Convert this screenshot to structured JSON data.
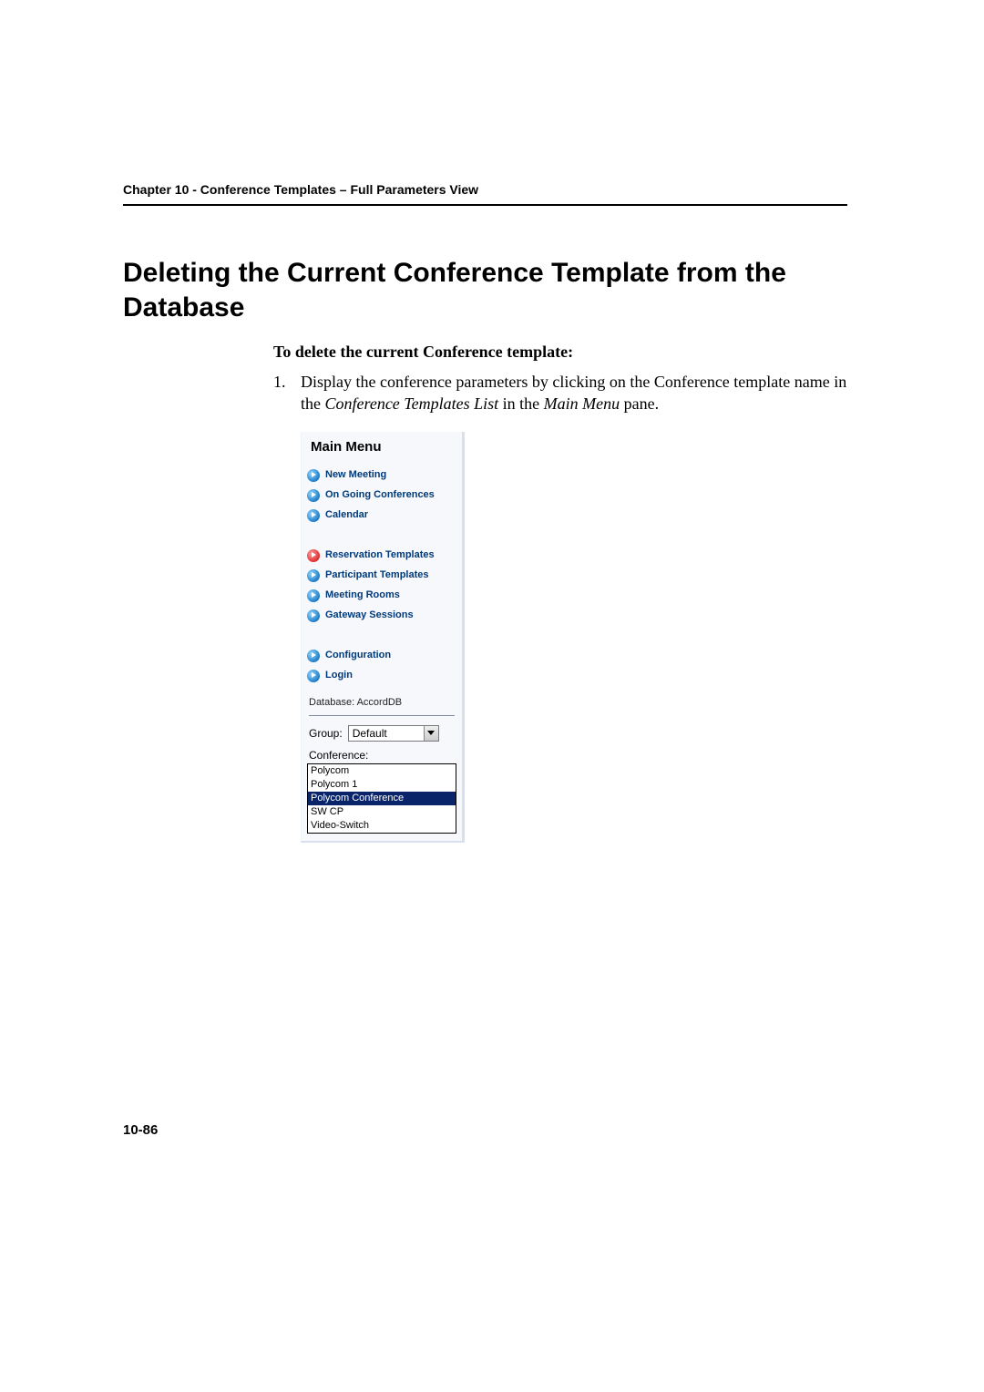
{
  "header": {
    "chapter": "Chapter 10 - Conference Templates – Full Parameters View"
  },
  "section": {
    "title": "Deleting the Current Conference Template from the Database",
    "intro": "To delete the current Conference template:",
    "step_number": "1.",
    "step_text_pre": "Display the conference parameters by clicking on the Conference template name in the ",
    "step_em1": "Conference Templates List",
    "step_mid": " in the ",
    "step_em2": "Main Menu",
    "step_post": " pane."
  },
  "panel": {
    "title": "Main Menu",
    "items_a": [
      {
        "label": "New Meeting"
      },
      {
        "label": "On Going Conferences"
      },
      {
        "label": "Calendar"
      }
    ],
    "items_b": [
      {
        "label": "Reservation Templates",
        "active": true
      },
      {
        "label": "Participant Templates"
      },
      {
        "label": "Meeting Rooms"
      },
      {
        "label": "Gateway Sessions"
      }
    ],
    "items_c": [
      {
        "label": "Configuration"
      },
      {
        "label": "Login"
      }
    ],
    "database_label": "Database: AccordDB",
    "group_label": "Group:",
    "group_value": "Default",
    "conference_label": "Conference:",
    "conference_list": [
      {
        "name": "Polycom",
        "selected": false
      },
      {
        "name": "Polycom 1",
        "selected": false
      },
      {
        "name": "Polycom Conference",
        "selected": true
      },
      {
        "name": "SW CP",
        "selected": false
      },
      {
        "name": "Video-Switch",
        "selected": false
      }
    ]
  },
  "footer": {
    "page_number": "10-86"
  }
}
